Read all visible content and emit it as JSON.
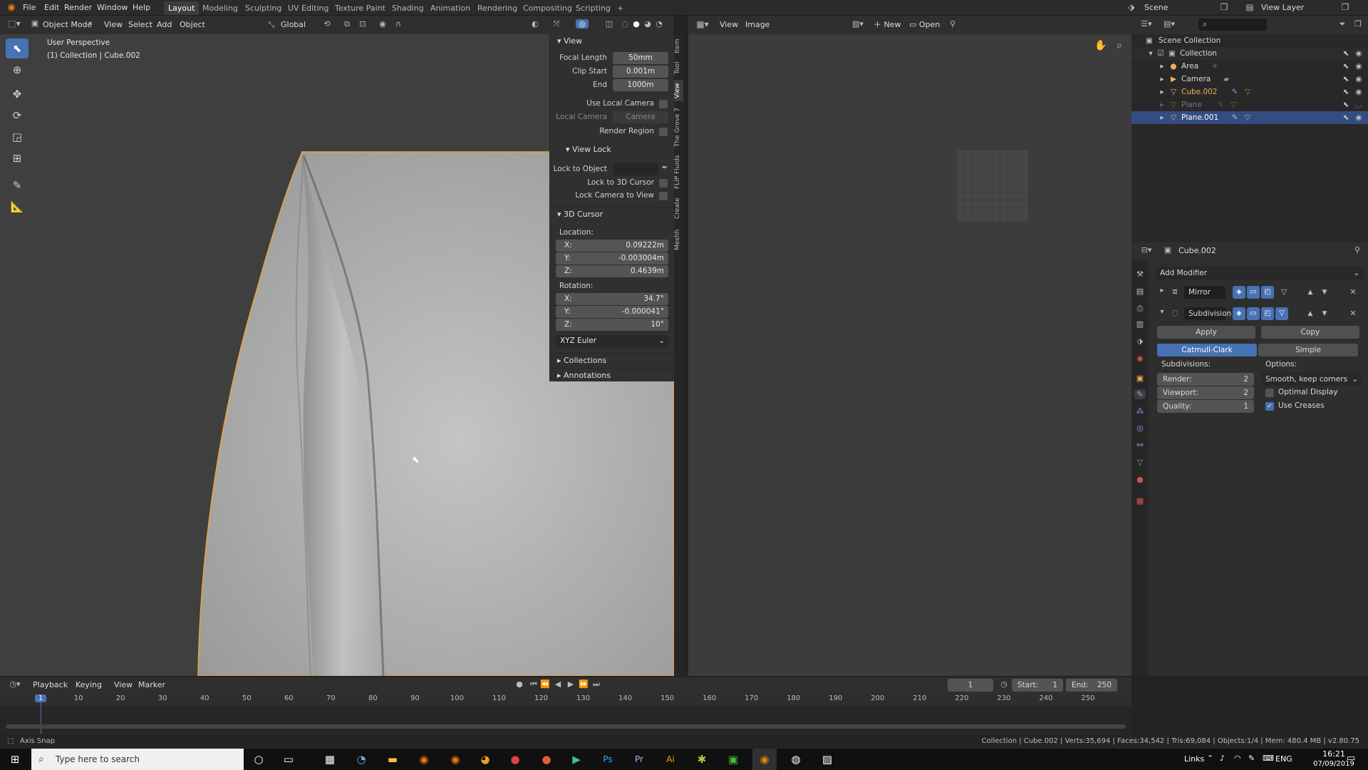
{
  "topbar": {
    "menus": [
      "File",
      "Edit",
      "Render",
      "Window",
      "Help"
    ],
    "tabs": [
      "Layout",
      "Modeling",
      "Sculpting",
      "UV Editing",
      "Texture Paint",
      "Shading",
      "Animation",
      "Rendering",
      "Compositing",
      "Scripting"
    ],
    "active_tab": "Layout",
    "add_tab": "+",
    "scene_label": "Scene",
    "view_layer_label": "View Layer"
  },
  "viewport_header": {
    "mode": "Object Mode",
    "menus": [
      "View",
      "Select",
      "Add",
      "Object"
    ],
    "orientation": "Global"
  },
  "viewport": {
    "perspective": "User Perspective",
    "collection_info": "(1) Collection | Cube.002"
  },
  "npanel": {
    "view": {
      "title": "View",
      "focal_length_label": "Focal Length",
      "focal_length": "50mm",
      "clip_start_label": "Clip Start",
      "clip_start": "0.001m",
      "end_label": "End",
      "end": "1000m",
      "use_local_camera": "Use Local Camera",
      "local_camera_label": "Local Camera",
      "local_camera_value": "Camera",
      "render_region": "Render Region"
    },
    "view_lock": {
      "title": "View Lock",
      "lock_to_object": "Lock to Object",
      "lock_to_3d_cursor": "Lock to 3D Cursor",
      "lock_camera_to_view": "Lock Camera to View"
    },
    "cursor": {
      "title": "3D Cursor",
      "location_label": "Location:",
      "x_label": "X:",
      "x": "0.09222m",
      "y_label": "Y:",
      "y": "-0.003004m",
      "z_label": "Z:",
      "z": "0.4639m",
      "rotation_label": "Rotation:",
      "rx": "34.7°",
      "ry": "-0.000041°",
      "rz": "10°",
      "rotation_mode": "XYZ Euler"
    },
    "collections": "Collections",
    "annotations": "Annotations",
    "side_tabs": [
      "Item",
      "Tool",
      "View",
      "The Grove 7",
      "FLIP Fluids",
      "Create",
      "Meshh"
    ]
  },
  "image_editor": {
    "menus": [
      "View",
      "Image"
    ],
    "new_label": "New",
    "open_label": "Open"
  },
  "outliner": {
    "scene_collection": "Scene Collection",
    "collection": "Collection",
    "items": [
      {
        "name": "Area",
        "color": "#e0e0e0"
      },
      {
        "name": "Camera",
        "color": "#e0e0e0"
      },
      {
        "name": "Cube.002",
        "color": "#f0b050"
      },
      {
        "name": "Plane",
        "color": "#777777"
      },
      {
        "name": "Plane.001",
        "color": "#ffffff"
      }
    ]
  },
  "properties": {
    "object_name": "Cube.002",
    "add_modifier": "Add Modifier",
    "mirror_name": "Mirror",
    "subdivision_name": "Subdivision",
    "apply_label": "Apply",
    "copy_label": "Copy",
    "catmull_label": "Catmull-Clark",
    "simple_label": "Simple",
    "subdivisions_label": "Subdivisions:",
    "options_label": "Options:",
    "render_label": "Render:",
    "render_value": "2",
    "viewport_label": "Viewport:",
    "viewport_value": "2",
    "quality_label": "Quality:",
    "quality_value": "1",
    "uv_option": "Smooth, keep corners",
    "optimal_display": "Optimal Display",
    "use_creases": "Use Creases"
  },
  "timeline": {
    "menus": [
      "Playback",
      "Keying",
      "View",
      "Marker"
    ],
    "current_frame": "1",
    "start_label": "Start:",
    "start": "1",
    "end_label": "End:",
    "end": "250",
    "ruler": [
      "1",
      "10",
      "20",
      "30",
      "40",
      "50",
      "60",
      "70",
      "80",
      "90",
      "100",
      "110",
      "120",
      "130",
      "140",
      "150",
      "160",
      "170",
      "180",
      "190",
      "200",
      "210",
      "220",
      "230",
      "240",
      "250"
    ]
  },
  "status": {
    "left": "Axis Snap",
    "right": "Collection | Cube.002 | Verts:35,694 | Faces:34,542 | Tris:69,084 | Objects:1/4 | Mem: 480.4 MB | v2.80.75"
  },
  "taskbar": {
    "search_placeholder": "Type here to search",
    "links": "Links",
    "lang": "ENG",
    "time": "16:21",
    "date": "07/09/2019"
  },
  "colors": {
    "accent": "#4772b3",
    "selection_outline": "#f0a040"
  }
}
